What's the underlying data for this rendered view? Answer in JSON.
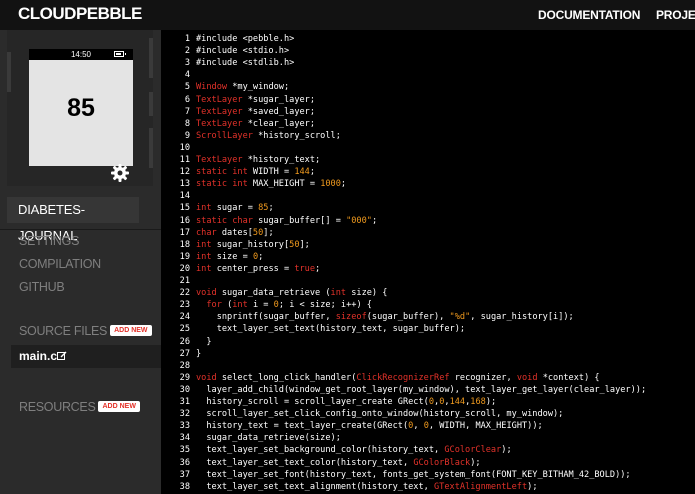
{
  "header": {
    "logo": "CLOUDPEBBLE",
    "nav": [
      "DOCUMENTATION",
      "PROJEC"
    ]
  },
  "emulator": {
    "time": "14:50",
    "value": "85"
  },
  "sidebar": {
    "project_title": "DIABETES-JOURNAL",
    "links": [
      "SETTINGS",
      "COMPILATION",
      "GITHUB"
    ],
    "source_files_label": "SOURCE FILES",
    "add_new_label": "ADD NEW",
    "file_name": "main.c",
    "resources_label": "RESOURCES"
  },
  "colors": {
    "keyword": "#e3322a",
    "number": "#f09a1e",
    "background": "#000000",
    "sidebar": "#2b2b2b"
  },
  "code": [
    [
      [
        "",
        "#include <pebble.h>"
      ]
    ],
    [
      [
        "",
        "#include <stdio.h>"
      ]
    ],
    [
      [
        "",
        "#include <stdlib.h>"
      ]
    ],
    [],
    [
      [
        "kw",
        "Window"
      ],
      [
        "",
        " *my_window;"
      ]
    ],
    [
      [
        "kw",
        "TextLayer"
      ],
      [
        "",
        " *sugar_layer;"
      ]
    ],
    [
      [
        "kw",
        "TextLayer"
      ],
      [
        "",
        " *saved_layer;"
      ]
    ],
    [
      [
        "kw",
        "TextLayer"
      ],
      [
        "",
        " *clear_layer;"
      ]
    ],
    [
      [
        "kw",
        "ScrollLayer"
      ],
      [
        "",
        " *history_scroll;"
      ]
    ],
    [],
    [
      [
        "kw",
        "TextLayer"
      ],
      [
        "",
        " *history_text;"
      ]
    ],
    [
      [
        "kw",
        "static int"
      ],
      [
        "",
        " WIDTH = "
      ],
      [
        "num",
        "144"
      ],
      [
        "",
        ";"
      ]
    ],
    [
      [
        "kw",
        "static int"
      ],
      [
        "",
        " MAX_HEIGHT = "
      ],
      [
        "num",
        "1000"
      ],
      [
        "",
        ";"
      ]
    ],
    [],
    [
      [
        "kw",
        "int"
      ],
      [
        "",
        " sugar = "
      ],
      [
        "num",
        "85"
      ],
      [
        "",
        ";"
      ]
    ],
    [
      [
        "kw",
        "static char"
      ],
      [
        "",
        " sugar_buffer[] = "
      ],
      [
        "str",
        "\"000\""
      ],
      [
        "",
        ";"
      ]
    ],
    [
      [
        "kw",
        "char"
      ],
      [
        "",
        " dates["
      ],
      [
        "num",
        "50"
      ],
      [
        "",
        "];"
      ]
    ],
    [
      [
        "kw",
        "int"
      ],
      [
        "",
        " sugar_history["
      ],
      [
        "num",
        "50"
      ],
      [
        "",
        "];"
      ]
    ],
    [
      [
        "kw",
        "int"
      ],
      [
        "",
        " size = "
      ],
      [
        "num",
        "0"
      ],
      [
        "",
        ";"
      ]
    ],
    [
      [
        "kw",
        "int"
      ],
      [
        "",
        " center_press = "
      ],
      [
        "kw",
        "true"
      ],
      [
        "",
        ";"
      ]
    ],
    [],
    [
      [
        "kw",
        "void"
      ],
      [
        "",
        " sugar_data_retrieve ("
      ],
      [
        "kw",
        "int"
      ],
      [
        "",
        " size) {"
      ]
    ],
    [
      [
        "",
        "  "
      ],
      [
        "kw",
        "for"
      ],
      [
        "",
        " ("
      ],
      [
        "kw",
        "int"
      ],
      [
        "",
        " i = "
      ],
      [
        "num",
        "0"
      ],
      [
        "",
        "; i < size; i++) {"
      ]
    ],
    [
      [
        "",
        "    snprintf(sugar_buffer, "
      ],
      [
        "kw",
        "sizeof"
      ],
      [
        "",
        "(sugar_buffer), "
      ],
      [
        "str",
        "\"%d\""
      ],
      [
        "",
        ", sugar_history[i]);"
      ]
    ],
    [
      [
        "",
        "    text_layer_set_text(history_text, sugar_buffer);"
      ]
    ],
    [
      [
        "",
        "  }"
      ]
    ],
    [
      [
        "",
        "}"
      ]
    ],
    [],
    [
      [
        "kw",
        "void"
      ],
      [
        "",
        " select_long_click_handler("
      ],
      [
        "kw",
        "ClickRecognizerRef"
      ],
      [
        "",
        " recognizer, "
      ],
      [
        "kw",
        "void"
      ],
      [
        "",
        " *context) {"
      ]
    ],
    [
      [
        "",
        "  layer_add_child(window_get_root_layer(my_window), text_layer_get_layer(clear_layer));"
      ]
    ],
    [
      [
        "",
        "  history_scroll = scroll_layer_create GRect("
      ],
      [
        "num",
        "0"
      ],
      [
        "",
        ","
      ],
      [
        "num",
        "0"
      ],
      [
        "",
        ","
      ],
      [
        "num",
        "144"
      ],
      [
        "",
        ","
      ],
      [
        "num",
        "168"
      ],
      [
        "",
        ");"
      ]
    ],
    [
      [
        "",
        "  scroll_layer_set_click_config_onto_window(history_scroll, my_window);"
      ]
    ],
    [
      [
        "",
        "  history_text = text_layer_create(GRect("
      ],
      [
        "num",
        "0"
      ],
      [
        "",
        ", "
      ],
      [
        "num",
        "0"
      ],
      [
        "",
        ", WIDTH, MAX_HEIGHT));"
      ]
    ],
    [
      [
        "",
        "  sugar_data_retrieve(size);"
      ]
    ],
    [
      [
        "",
        "  text_layer_set_background_color(history_text, "
      ],
      [
        "kw",
        "GColorClear"
      ],
      [
        "",
        ");"
      ]
    ],
    [
      [
        "",
        "  text_layer_set_text_color(history_text, "
      ],
      [
        "kw",
        "GColorBlack"
      ],
      [
        "",
        ");"
      ]
    ],
    [
      [
        "",
        "  text_layer_set_font(history_text, fonts_get_system_font(FONT_KEY_BITHAM_42_BOLD));"
      ]
    ],
    [
      [
        "",
        "  text_layer_set_text_alignment(history_text, "
      ],
      [
        "kw",
        "GTextAlignmentLeft"
      ],
      [
        "",
        ");"
      ]
    ]
  ]
}
